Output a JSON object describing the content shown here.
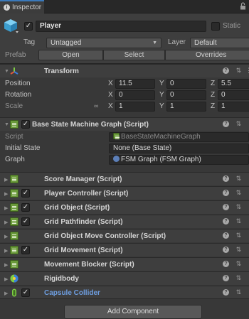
{
  "tab": {
    "label": "Inspector"
  },
  "gameobject": {
    "active": true,
    "name": "Player",
    "static_label": "Static",
    "tag_label": "Tag",
    "tag_value": "Untagged",
    "layer_label": "Layer",
    "layer_value": "Default",
    "prefab_label": "Prefab",
    "open_label": "Open",
    "select_label": "Select",
    "overrides_label": "Overrides"
  },
  "transform": {
    "title": "Transform",
    "position_label": "Position",
    "rotation_label": "Rotation",
    "scale_label": "Scale",
    "axes": {
      "x": "X",
      "y": "Y",
      "z": "Z"
    },
    "position": {
      "x": "11.5",
      "y": "0",
      "z": "5.5"
    },
    "rotation": {
      "x": "0",
      "y": "0",
      "z": "0"
    },
    "scale": {
      "x": "1",
      "y": "1",
      "z": "1"
    }
  },
  "base_state": {
    "title": "Base State Machine Graph (Script)",
    "script_label": "Script",
    "script_value": "BaseStateMachineGraph",
    "initial_state_label": "Initial State",
    "initial_state_value": "None (Base State)",
    "graph_label": "Graph",
    "graph_value": "FSM Graph (FSM Graph)"
  },
  "components": [
    {
      "title": "Score Manager (Script)",
      "checkbox": false,
      "icon": "script-icon"
    },
    {
      "title": "Player Controller (Script)",
      "checkbox": true,
      "icon": "script-icon"
    },
    {
      "title": "Grid Object (Script)",
      "checkbox": true,
      "icon": "script-icon"
    },
    {
      "title": "Grid Pathfinder (Script)",
      "checkbox": true,
      "icon": "script-icon"
    },
    {
      "title": "Grid Object Move Controller (Script)",
      "checkbox": false,
      "icon": "script-icon"
    },
    {
      "title": "Grid Movement (Script)",
      "checkbox": true,
      "icon": "script-icon"
    },
    {
      "title": "Movement Blocker (Script)",
      "checkbox": false,
      "icon": "script-icon"
    },
    {
      "title": "Rigidbody",
      "checkbox": false,
      "icon": "rigidbody-icon"
    },
    {
      "title": "Capsule Collider",
      "checkbox": true,
      "icon": "capsule-collider-icon"
    }
  ],
  "add_component_label": "Add Component",
  "colors": {
    "accent": "#3a79bb",
    "script_green": "#6a9a3a",
    "collider_blue": "#6e9ee0"
  }
}
